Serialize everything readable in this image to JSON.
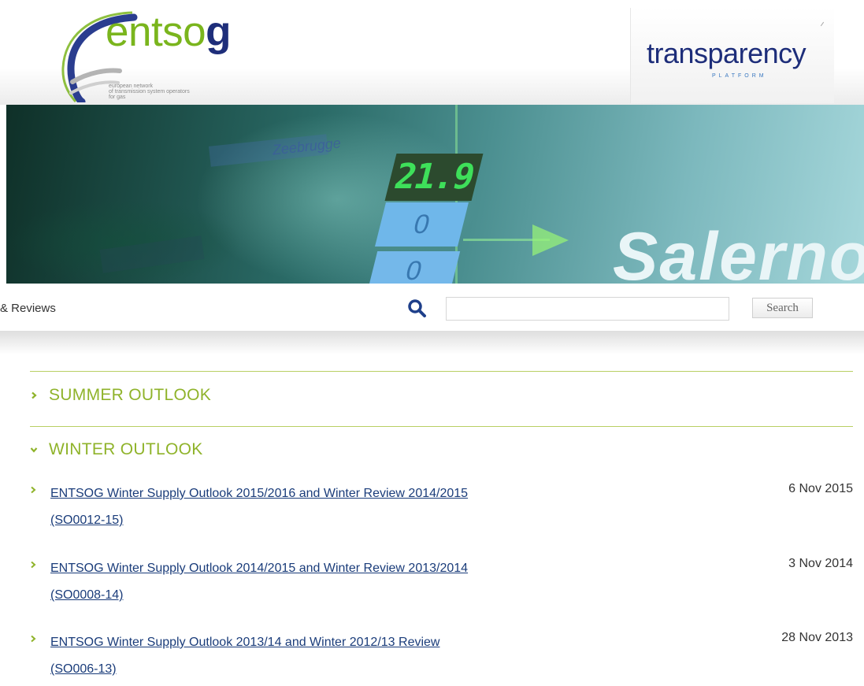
{
  "header": {
    "logo": {
      "word_light": "entso",
      "word_bold": "g",
      "tagline_lines": [
        "european network",
        "of transmission system operators",
        "for gas"
      ]
    },
    "platform": {
      "word": "transparency",
      "subword": "PLATFORM"
    }
  },
  "banner": {
    "display_green": "21.9",
    "display_blue_1": "0",
    "display_blue_2": "0",
    "blur_text": "Zeebrugge",
    "city_text": "Salerno"
  },
  "nav": {
    "partial_text": "& Reviews"
  },
  "search": {
    "input_value": "",
    "button_label": "Search"
  },
  "sections": [
    {
      "label": "SUMMER OUTLOOK",
      "expanded": false
    },
    {
      "label": "WINTER OUTLOOK",
      "expanded": true
    }
  ],
  "winter_items": [
    {
      "title_line1": "ENTSOG Winter Supply Outlook 2015/2016 and Winter Review 2014/2015",
      "title_line2": "(SO0012-15)",
      "date": "6 Nov 2015"
    },
    {
      "title_line1": "ENTSOG Winter Supply Outlook 2014/2015 and Winter Review 2013/2014",
      "title_line2": "(SO0008-14)",
      "date": "3 Nov 2014"
    },
    {
      "title_line1": "ENTSOG Winter Supply Outlook 2013/14 and Winter 2012/13 Review",
      "title_line2": "(SO006-13)",
      "date": "28 Nov 2013"
    }
  ],
  "colors": {
    "accent_green": "#8fb32a",
    "link_blue": "#1a3c7a",
    "brand_navy": "#1e2e7a",
    "rule_green": "#b9cf64"
  },
  "icons": {
    "search": "search-icon",
    "collapsed": "chevron-right-icon",
    "expanded": "chevron-down-icon",
    "bullet": "chevron-right-icon"
  }
}
